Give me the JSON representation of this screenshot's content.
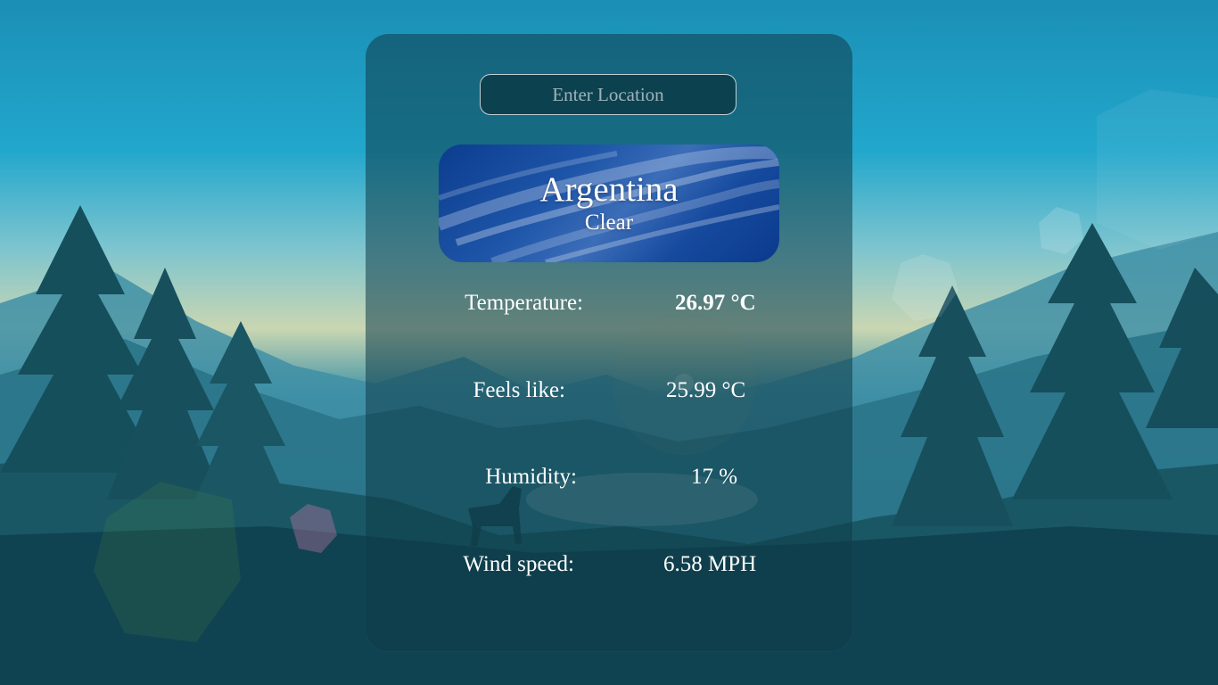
{
  "search": {
    "placeholder": "Enter Location"
  },
  "location": {
    "city": "Argentina",
    "condition": "Clear"
  },
  "stats": [
    {
      "label": "Temperature:",
      "value": "26.97 °C"
    },
    {
      "label": "Feels like:",
      "value": "25.99 °C"
    },
    {
      "label": "Humidity:",
      "value": "17 %"
    },
    {
      "label": "Wind speed:",
      "value": "6.58 MPH"
    }
  ],
  "colors": {
    "card_background": "#0e3c48",
    "text": "#ffffff",
    "sky_panel": "#1e55a8"
  }
}
